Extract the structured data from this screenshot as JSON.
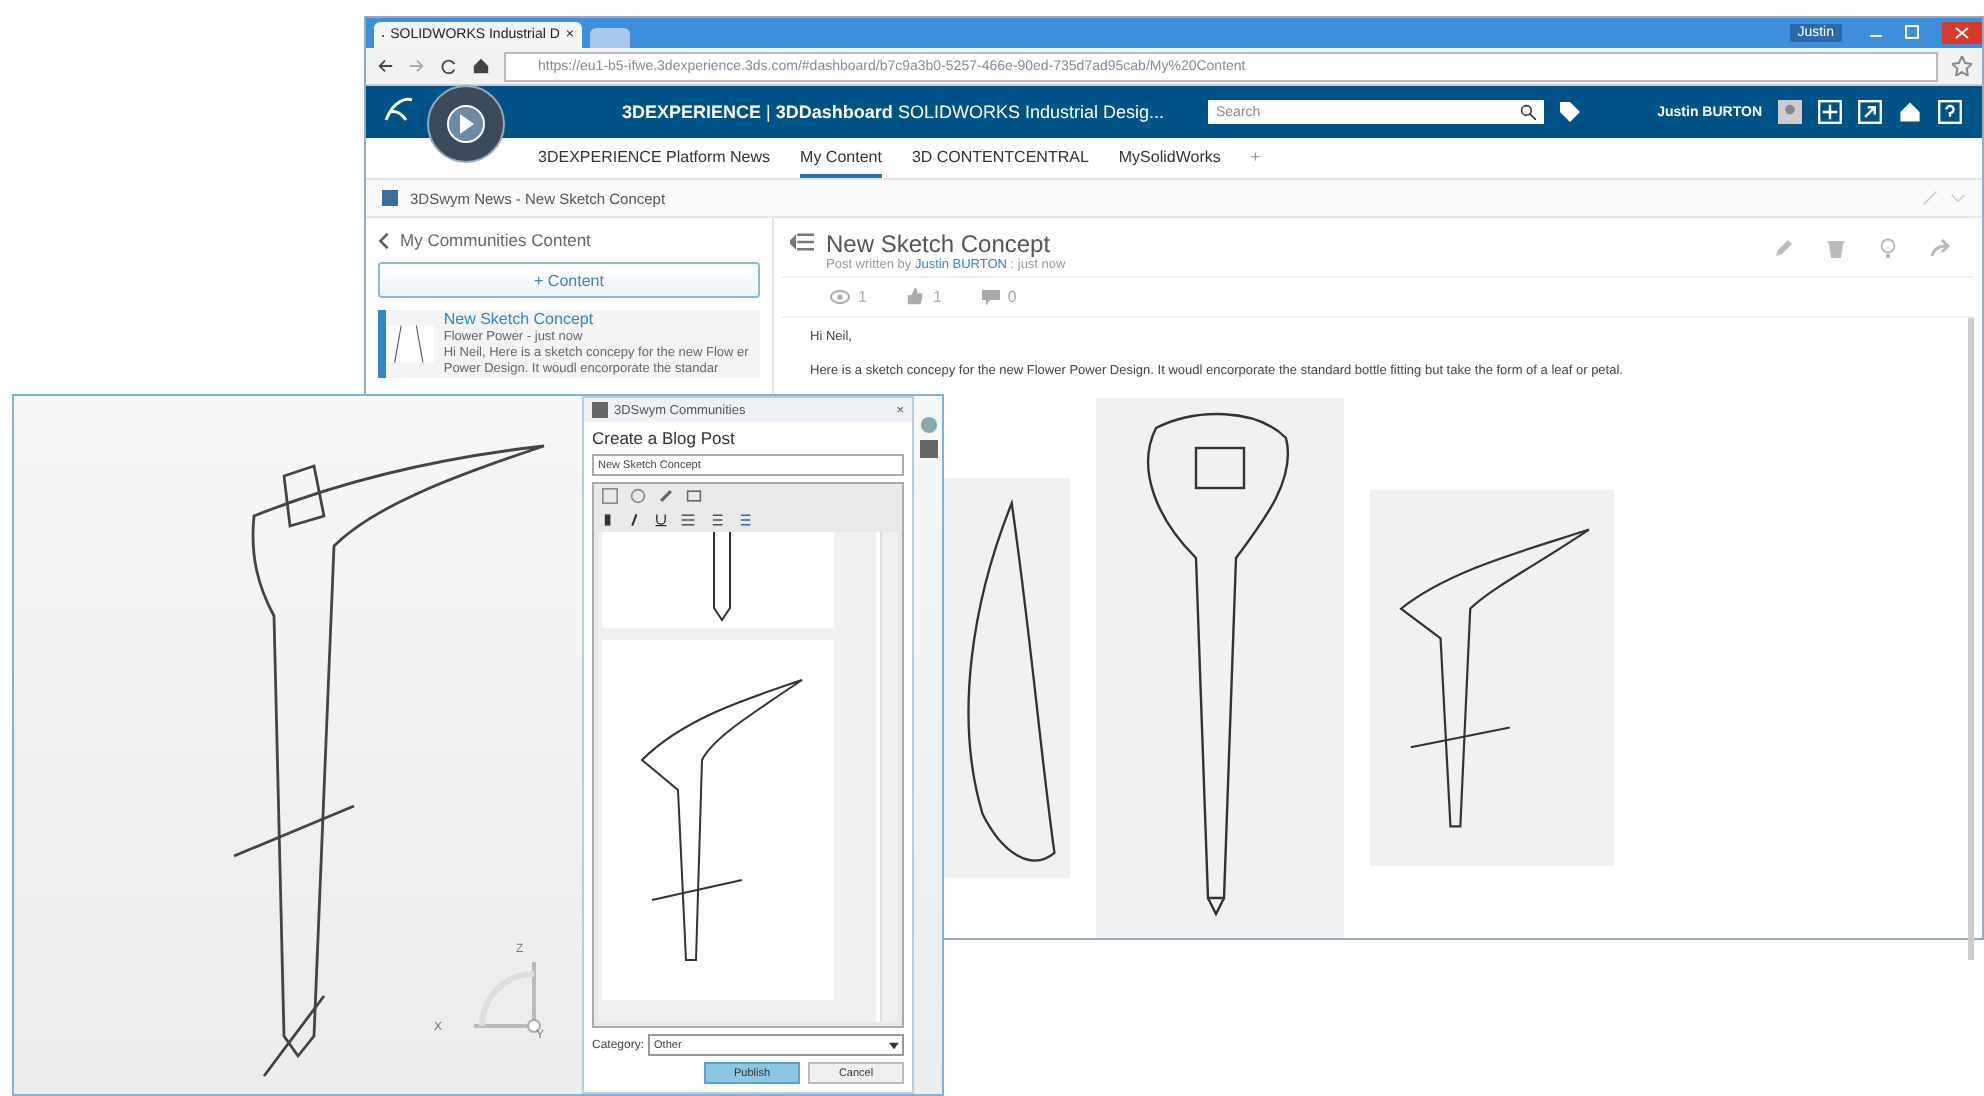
{
  "browser": {
    "tab_title": "SOLIDWORKS Industrial D",
    "tab_close": "×",
    "user": "Justin",
    "url": "https://eu1-b5-ifwe.3dexperience.3ds.com/#dashboard/b7c9a3b0-5257-466e-90ed-735d7ad95cab/My%20Content"
  },
  "header": {
    "brand": "3DEXPERIENCE",
    "separator": "|",
    "dashboard": "3DDashboard",
    "app": "SOLIDWORKS Industrial Desig...",
    "search_placeholder": "Search",
    "user": "Justin BURTON"
  },
  "dashboard_tabs": [
    {
      "label": "3DEXPERIENCE Platform News",
      "selected": false
    },
    {
      "label": "My Content",
      "selected": true
    },
    {
      "label": "3D CONTENTCENTRAL",
      "selected": false
    },
    {
      "label": "MySolidWorks",
      "selected": false
    }
  ],
  "add_tab": "+",
  "widget": {
    "title": "3DSwym News - New Sketch Concept"
  },
  "sidebar": {
    "back_label": "My Communities Content",
    "add_button": "+ Content",
    "items": [
      {
        "title": "New Sketch Concept",
        "meta": "Flower Power - just now",
        "excerpt": "Hi Neil, Here is a sketch concepy for the new Flow er Power Design. It woudl encorporate the standar",
        "selected": true
      }
    ]
  },
  "post": {
    "title": "New Sketch Concept",
    "byline_prefix": "Post written by",
    "author": "Justin BURTON",
    "byline_suffix": ": just now",
    "stats": [
      {
        "kind": "views",
        "count": "1"
      },
      {
        "kind": "likes",
        "count": "1"
      },
      {
        "kind": "comments",
        "count": "0"
      }
    ],
    "body": [
      "Hi Neil,",
      "Here is a sketch concepy for the new Flower Power Design. It woudl encorporate the standard bottle fitting but take the form of a leaf or petal."
    ],
    "sketches": [
      {
        "kind": "leaf"
      },
      {
        "kind": "bottle"
      },
      {
        "kind": "stem"
      }
    ]
  },
  "overlay": {
    "panel_title": "3DSwym Communities",
    "panel_close": "×",
    "heading": "Create a Blog Post",
    "title_value": "New Sketch Concept",
    "category_label": "Category:",
    "category_value": "Other",
    "buttons": [
      {
        "label": "Publish",
        "primary": true
      },
      {
        "label": "Cancel",
        "primary": false
      }
    ],
    "triad": {
      "x": "X",
      "y": "Y",
      "z": "Z"
    }
  }
}
